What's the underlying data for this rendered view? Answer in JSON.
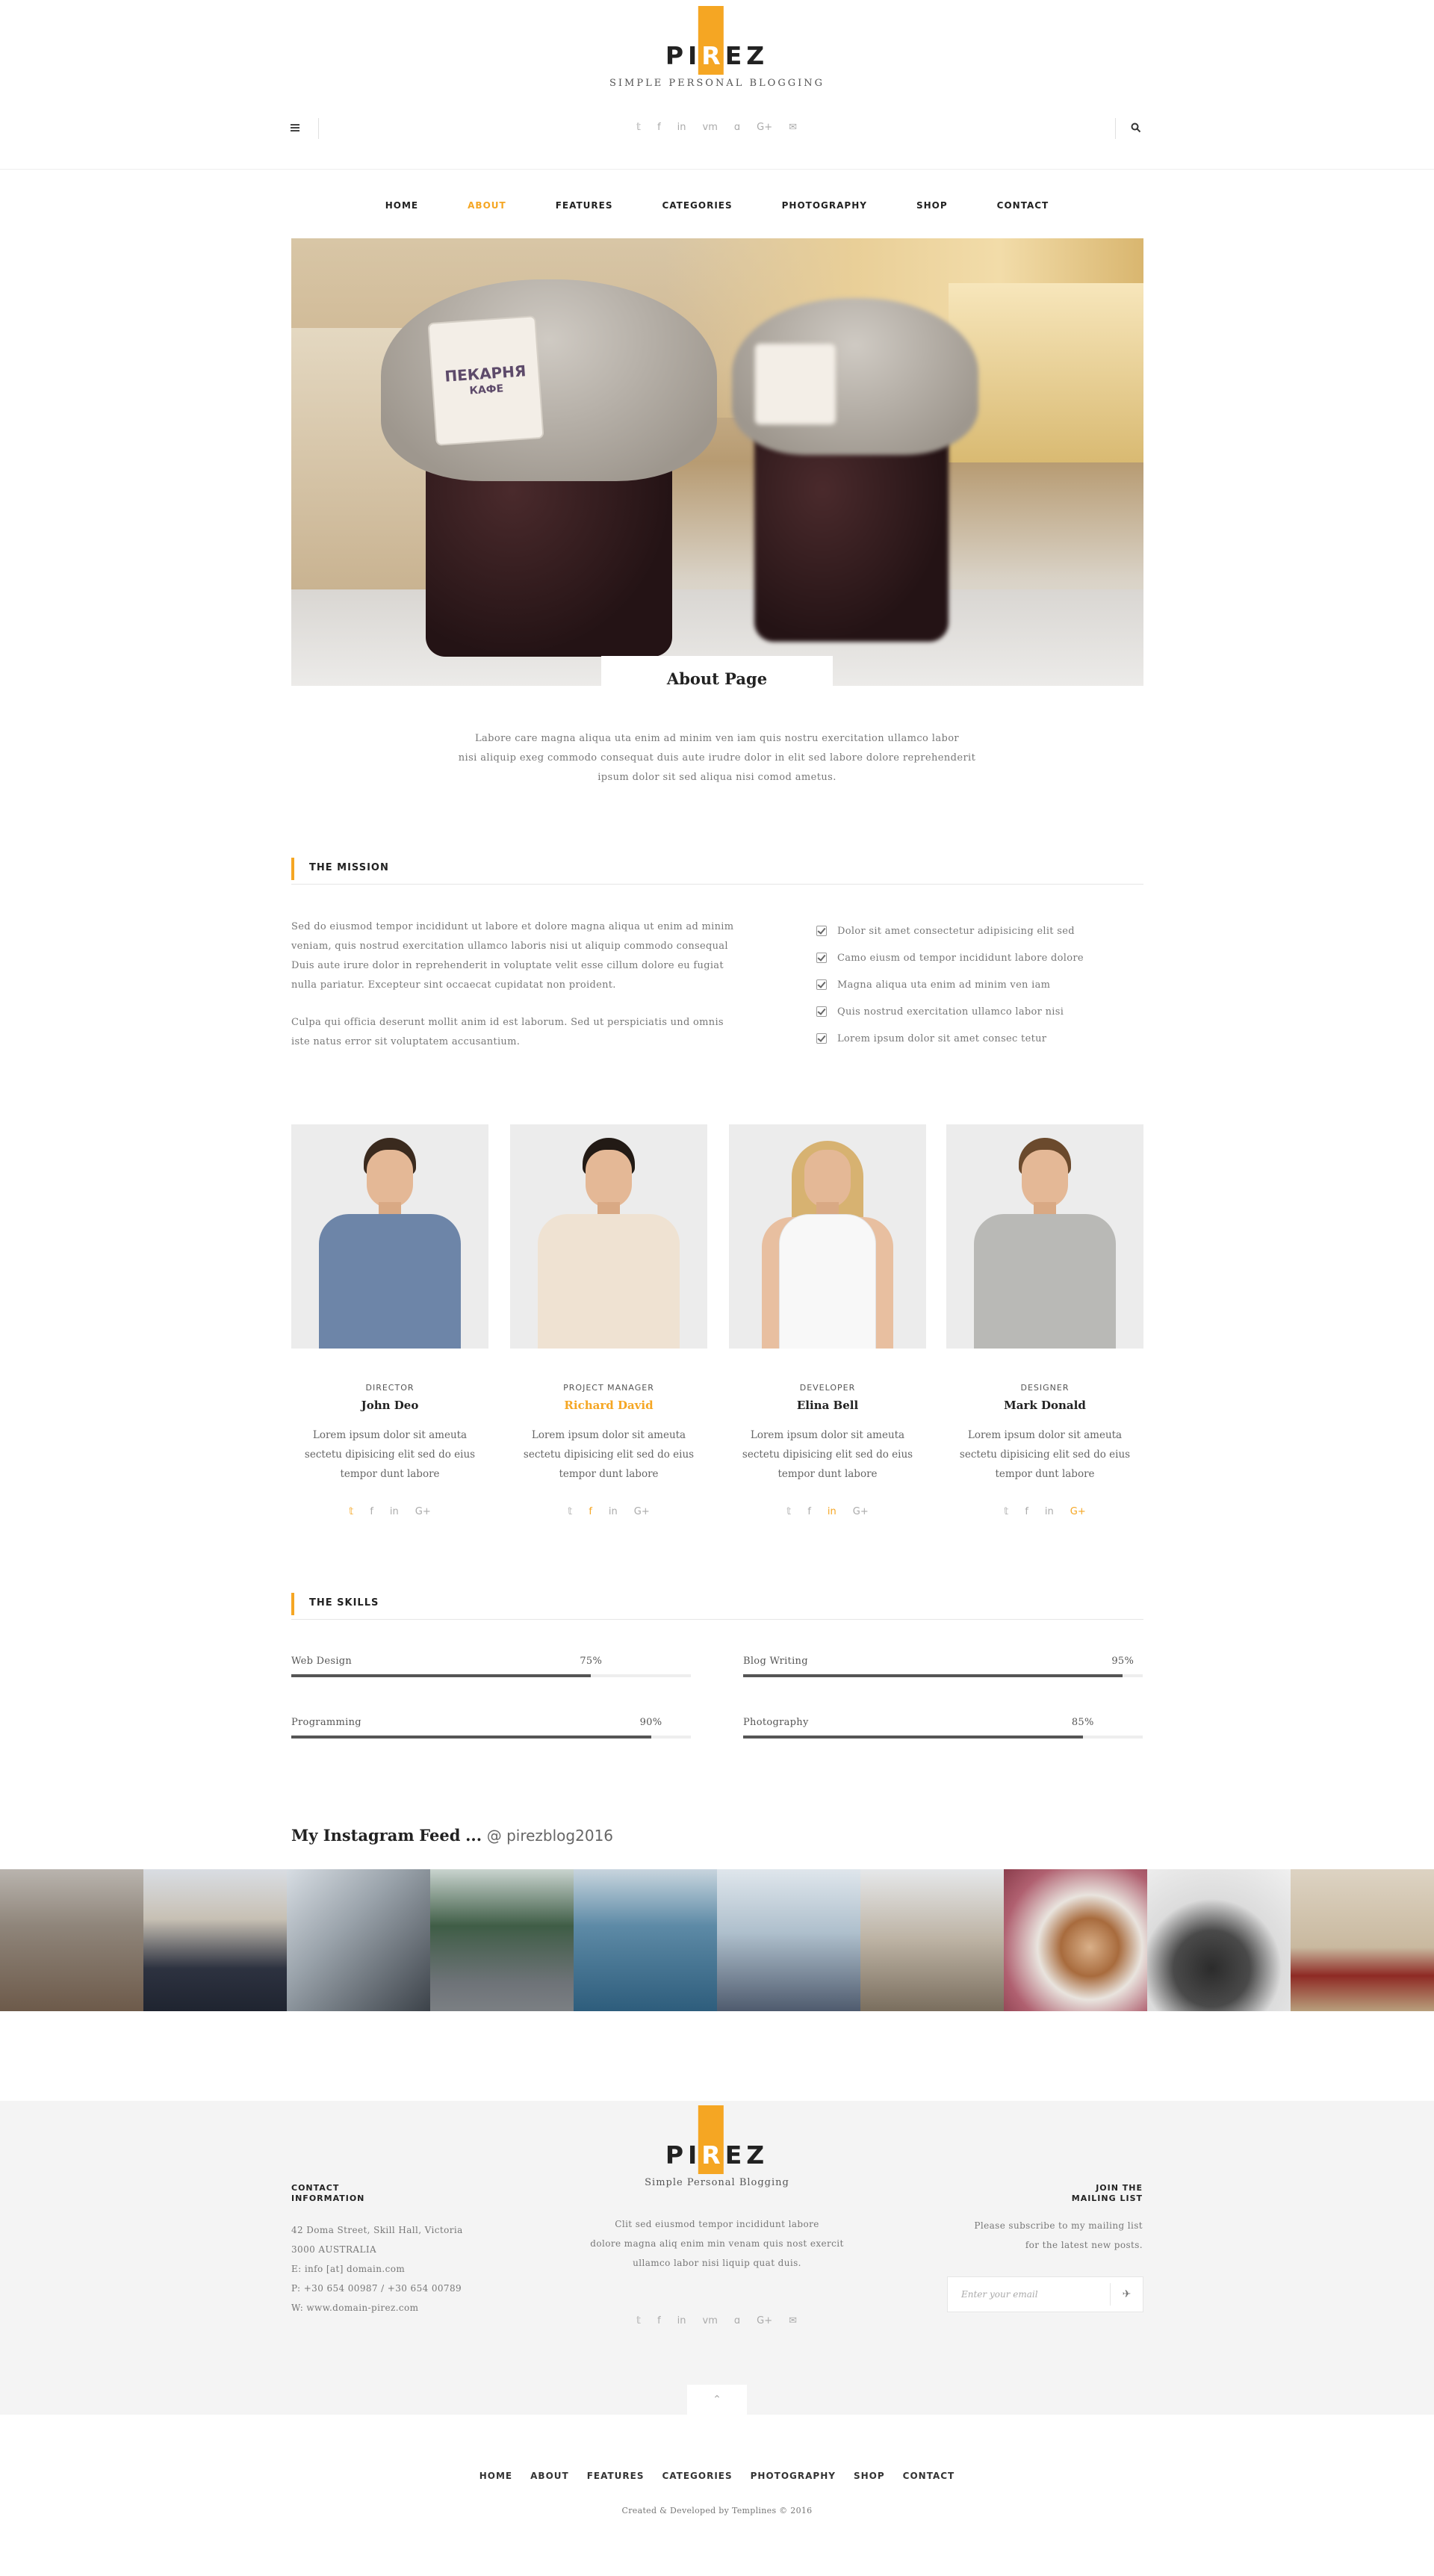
{
  "brand": {
    "logo_pre": "PI",
    "logo_hl": "R",
    "logo_post": "EZ",
    "tagline": "SIMPLE PERSONAL BLOGGING",
    "accent": "#f5a623"
  },
  "header": {
    "menu_icon": "hamburger-icon",
    "search_icon": "search-icon",
    "social": [
      {
        "name": "twitter-icon",
        "glyph": "𝕥"
      },
      {
        "name": "facebook-icon",
        "glyph": "f"
      },
      {
        "name": "linkedin-icon",
        "glyph": "in"
      },
      {
        "name": "vimeo-icon",
        "glyph": "vm"
      },
      {
        "name": "rss-icon",
        "glyph": "ɑ"
      },
      {
        "name": "google-plus-icon",
        "glyph": "G+"
      },
      {
        "name": "mail-icon",
        "glyph": "✉"
      }
    ]
  },
  "nav": [
    "HOME",
    "ABOUT",
    "FEATURES",
    "CATEGORIES",
    "PHOTOGRAPHY",
    "SHOP",
    "CONTACT"
  ],
  "nav_active": "ABOUT",
  "hero": {
    "tag_text_1": "ПЕКАРНЯ",
    "tag_text_2": "КАФЕ",
    "page_title": "About Page",
    "intro_1": "Labore care magna aliqua uta enim ad minim ven iam quis nostru exercitation ullamco labor",
    "intro_2": "nisi aliquip exeg commodo consequat duis aute irudre dolor in elit sed labore dolore reprehenderit",
    "intro_3": "ipsum dolor sit sed aliqua nisi comod ametus."
  },
  "mission": {
    "title": "THE MISSION",
    "p1": [
      "Sed do eiusmod tempor incididunt ut labore et dolore magna aliqua ut enim ad minim",
      "veniam, quis nostrud exercitation ullamco laboris nisi ut aliquip commodo consequal",
      "Duis aute irure dolor in reprehenderit in voluptate velit esse cillum dolore eu fugiat",
      "nulla pariatur. Excepteur sint occaecat cupidatat non proident."
    ],
    "p2": [
      "Culpa qui officia deserunt mollit anim id est laborum. Sed ut perspiciatis und omnis",
      "iste natus error sit voluptatem accusantium."
    ],
    "list": [
      "Dolor sit amet consectetur adipisicing elit sed",
      "Camo eiusm od tempor incididunt labore dolore",
      "Magna aliqua uta enim ad minim ven iam",
      "Quis nostrud exercitation ullamco labor nisi",
      "Lorem ipsum dolor sit amet consec tetur"
    ]
  },
  "team": [
    {
      "role": "DIRECTOR",
      "name": "John Deo",
      "bio": [
        "Lorem ipsum dolor sit ameuta",
        "sectetu dipisicing elit sed do eius",
        "tempor dunt labore"
      ],
      "shirt": "#6d85a8",
      "hair": "#3a2a1e",
      "active_social": "twitter-icon"
    },
    {
      "role": "PROJECT MANAGER",
      "name": "Richard David",
      "bio": [
        "Lorem ipsum dolor sit ameuta",
        "sectetu dipisicing elit sed do eius",
        "tempor dunt labore"
      ],
      "shirt": "#efe2d2",
      "hair": "#221a15",
      "active_social": "facebook-icon"
    },
    {
      "role": "DEVELOPER",
      "name": "Elina Bell",
      "bio": [
        "Lorem ipsum dolor sit ameuta",
        "sectetu dipisicing elit sed do eius",
        "tempor dunt labore"
      ],
      "shirt": "#f8f8f8",
      "hair": "#d7b271",
      "active_social": "linkedin-icon"
    },
    {
      "role": "DESIGNER",
      "name": "Mark Donald",
      "bio": [
        "Lorem ipsum dolor sit ameuta",
        "sectetu dipisicing elit sed do eius",
        "tempor dunt labore"
      ],
      "shirt": "#b9b9b6",
      "hair": "#6b4a2d",
      "active_social": "google-plus-icon"
    }
  ],
  "team_social": [
    {
      "name": "twitter-icon",
      "glyph": "𝕥"
    },
    {
      "name": "facebook-icon",
      "glyph": "f"
    },
    {
      "name": "linkedin-icon",
      "glyph": "in"
    },
    {
      "name": "google-plus-icon",
      "glyph": "G+"
    }
  ],
  "skills": {
    "title": "THE SKILLS",
    "items": [
      {
        "label": "Web Design",
        "value": 75,
        "value_text": "75%"
      },
      {
        "label": "Blog Writing",
        "value": 95,
        "value_text": "95%"
      },
      {
        "label": "Programming",
        "value": 90,
        "value_text": "90%"
      },
      {
        "label": "Photography",
        "value": 85,
        "value_text": "85%"
      }
    ]
  },
  "instagram": {
    "title_bold": "My Instagram",
    "title_rest": "Feed",
    "ellipsis": "...",
    "handle": "@ pirezblog2016",
    "tiles": [
      {
        "name": "insta-pebbles-boots",
        "bg": "linear-gradient(180deg,#b9b4ae 0%,#8f857a 40%,#6d5a4a 100%)"
      },
      {
        "name": "insta-winter-hat",
        "bg": "linear-gradient(180deg,#d9dde3 0%,#c7c0b4 35%,#2d3240 70%,#1f2430 100%)"
      },
      {
        "name": "insta-skyscraper",
        "bg": "linear-gradient(135deg,#d7dde3 0%,#9aa3ab 40%,#3c4249 100%)"
      },
      {
        "name": "insta-forest-road",
        "bg": "linear-gradient(180deg,#c9d4cf 0%,#3f5d46 40%,#6e7378 80%,#7b7f83 100%)"
      },
      {
        "name": "insta-woman-sweater",
        "bg": "linear-gradient(180deg,#c8d5de 0%,#5d8aa6 40%,#2e5d7c 100%)"
      },
      {
        "name": "insta-boy-sea",
        "bg": "linear-gradient(180deg,#dfe6ec 0%,#aebfcc 45%,#4f5b6e 100%)"
      },
      {
        "name": "insta-stone-stack",
        "bg": "linear-gradient(180deg,#e6e8ea 0%,#bcb2a3 50%,#7a6e5e 100%)"
      },
      {
        "name": "insta-coffee",
        "bg": "radial-gradient(circle at 60% 55%,#d9b089 0%,#a86b3d 25%,#e9e4de 45%,#b06070 75%,#8a3d4c 100%)"
      },
      {
        "name": "insta-turntable",
        "bg": "radial-gradient(circle at 45% 70%,#2b2b2b 0%,#4a4a4a 30%,#dcdcdc 55%,#f0f0f0 100%)"
      },
      {
        "name": "insta-tricycle",
        "bg": "linear-gradient(180deg,#ddd3c3 0%,#c9b99f 55%,#8e2a24 75%,#b89f7c 100%)"
      }
    ]
  },
  "footer": {
    "logo_pre": "PI",
    "logo_hl": "R",
    "logo_post": "EZ",
    "tagline": "Simple Personal Blogging",
    "about": [
      "Clit sed eiusmod tempor incididunt labore",
      "dolore magna aliq enim min venam quis nost exercit",
      "ullamco labor nisi liquip quat duis."
    ],
    "contact_head_1": "CONTACT",
    "contact_head_2": "INFORMATION",
    "contact_lines": [
      "42 Doma Street, Skill Hall, Victoria",
      "3000 AUSTRALIA",
      "E: info [at] domain.com",
      "P: +30 654 00987  /  +30 654 00789",
      "W: www.domain-pirez.com"
    ],
    "mail_head_1": "JOIN THE",
    "mail_head_2": "MAILING LIST",
    "mail_text": [
      "Please subscribe to my mailing list",
      "for the latest new posts."
    ],
    "email_placeholder": "Enter your email",
    "send_icon": "send-icon",
    "to_top_icon": "chevron-up-icon",
    "bottom_nav": [
      "HOME",
      "ABOUT",
      "FEATURES",
      "CATEGORIES",
      "PHOTOGRAPHY",
      "SHOP",
      "CONTACT"
    ],
    "copyright": "Created & Developed by Templines © 2016"
  }
}
